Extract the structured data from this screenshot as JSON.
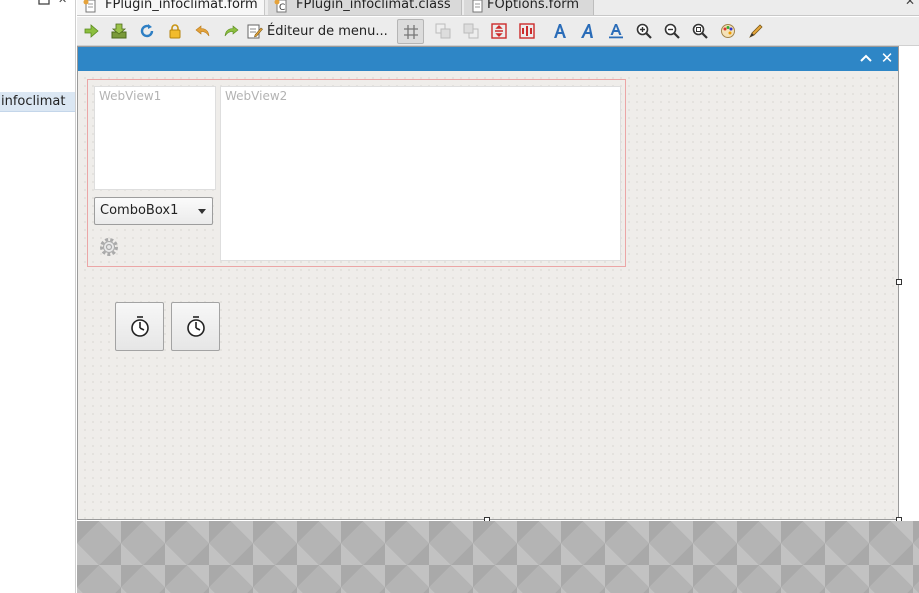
{
  "project_tree": {
    "selected_item": "infoclimat"
  },
  "tabs": [
    {
      "label": "FPlugin_infoclimat.form",
      "icon": "form-icon",
      "active": true
    },
    {
      "label": "FPlugin_infoclimat.class",
      "icon": "class-icon",
      "active": false
    },
    {
      "label": "FOptions.form",
      "icon": "form-icon",
      "active": false
    }
  ],
  "toolbar": {
    "menu_editor_label": "Éditeur de menu...",
    "icons": [
      "run-icon",
      "save-icon",
      "reload-icon",
      "lock-icon",
      "undo-icon",
      "redo-icon",
      "menu-editor-icon",
      "grid-icon",
      "bring-front-icon",
      "send-back-icon",
      "align-vertical-icon",
      "align-horizontal-icon",
      "font-icon",
      "font-italic-icon",
      "font-underline-icon",
      "zoom-in-icon",
      "zoom-out-icon",
      "zoom-fit-icon",
      "colors-icon",
      "properties-icon"
    ]
  },
  "form": {
    "titlebar_color": "#2e86c6",
    "controls": {
      "webview1_label": "WebView1",
      "webview2_label": "WebView2",
      "combobox_value": "ComboBox1"
    }
  },
  "colors": {
    "accent": "#2e86c6",
    "container_border": "#eba6a6",
    "form_background": "#efedea"
  }
}
